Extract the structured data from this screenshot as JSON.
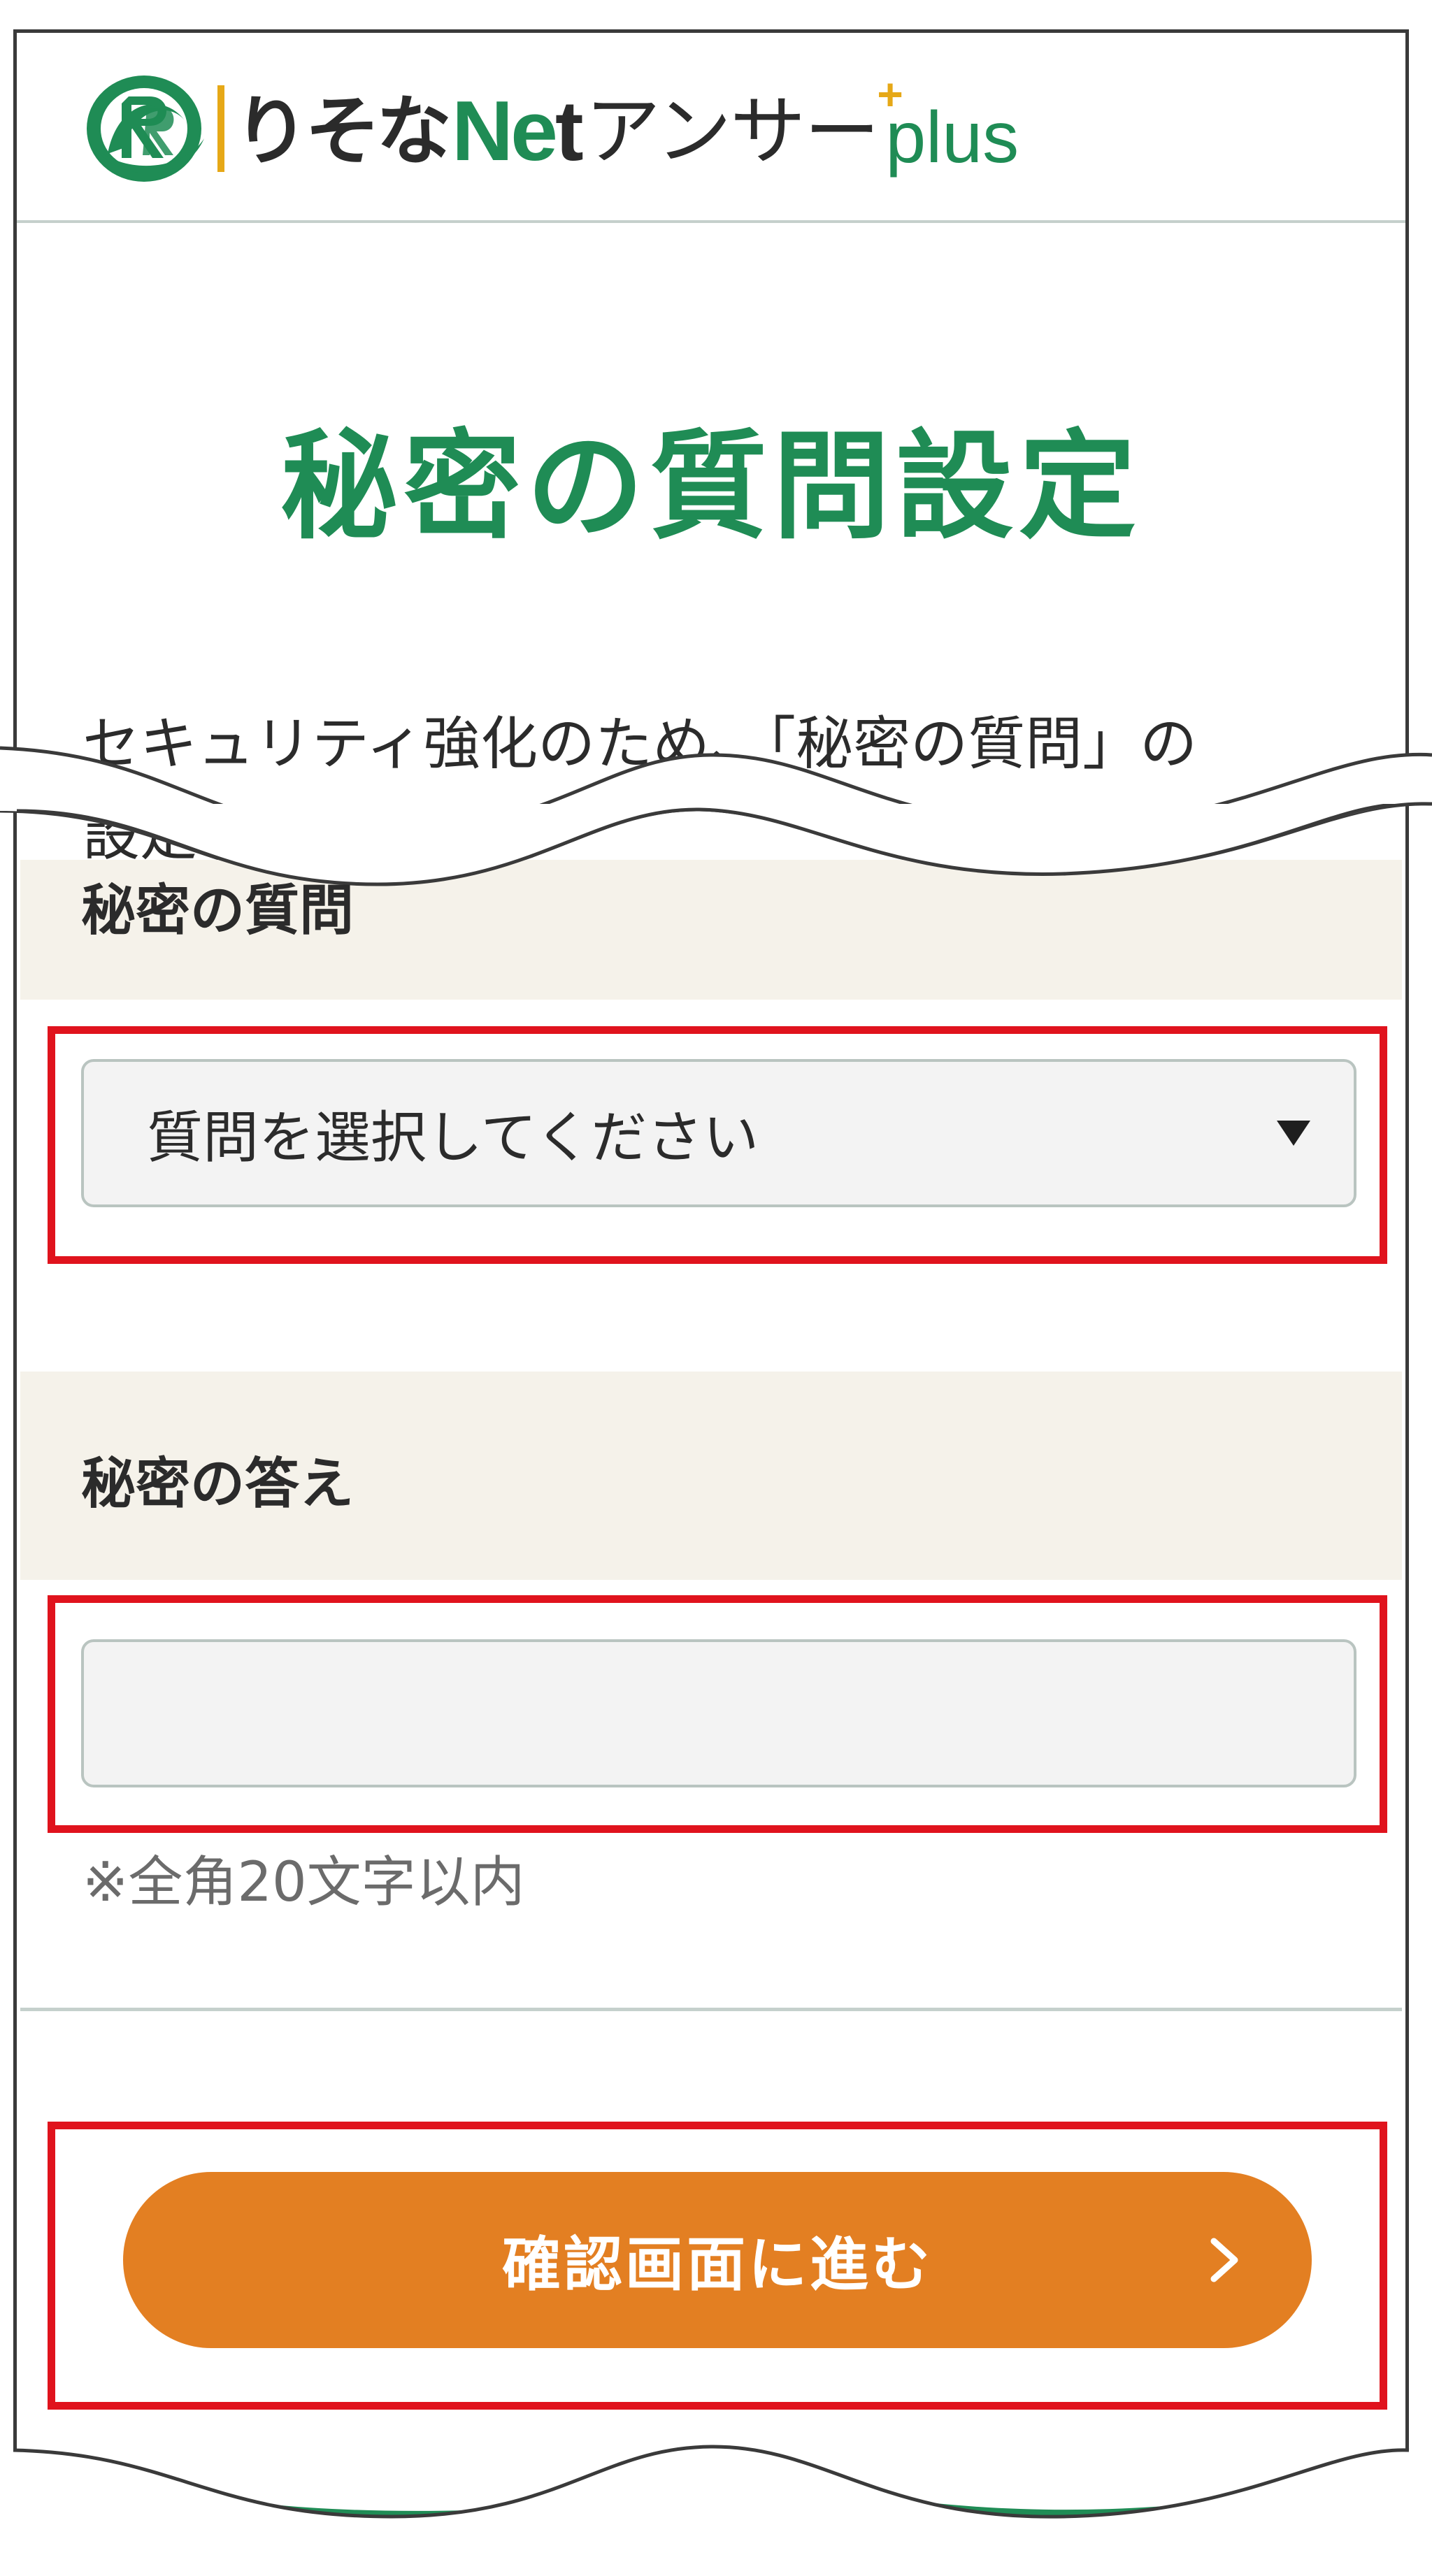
{
  "header": {
    "logo_risona": "りそな",
    "logo_net": "Ne",
    "logo_net_t": "t",
    "logo_answer": "アンサー",
    "logo_plus_sign": "+",
    "logo_plus": "plus"
  },
  "page": {
    "title": "秘密の質問設定",
    "intro_text": "セキュリティ強化のため、「秘密の質問」の",
    "intro_text_line2": "設定を行います。"
  },
  "question_section": {
    "label": "秘密の質問",
    "select_value": "質問を選択してください"
  },
  "answer_section": {
    "label": "秘密の答え",
    "input_value": "",
    "note": "※全角20文字以内"
  },
  "confirm_button": {
    "label": "確認画面に進む"
  },
  "colors": {
    "brand_green": "#1f8c55",
    "accent_orange": "#e37f22",
    "highlight_red": "#e0131d",
    "section_band": "#f5f2ea",
    "logo_yellow": "#e6a817"
  }
}
